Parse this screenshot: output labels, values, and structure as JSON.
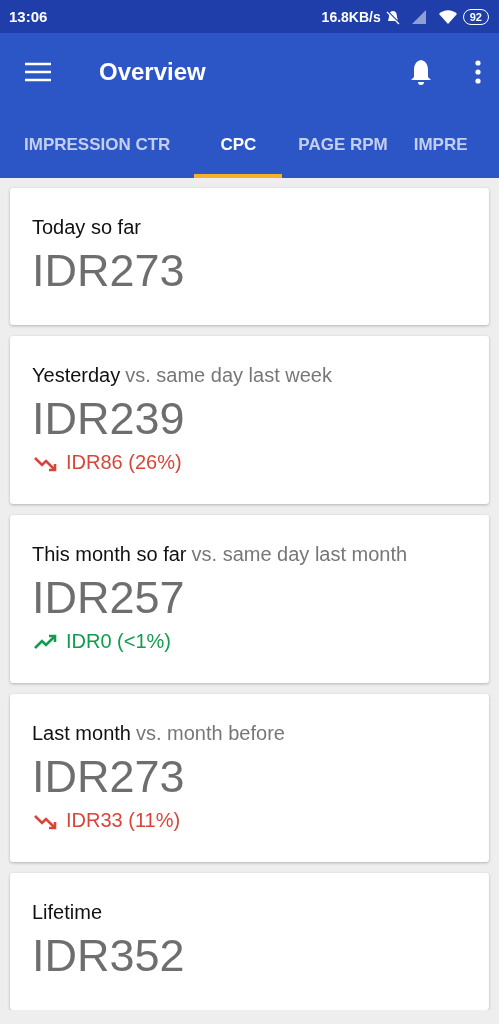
{
  "status_bar": {
    "time": "13:06",
    "speed": "16.8KB/s",
    "battery": "92"
  },
  "app_bar": {
    "title": "Overview"
  },
  "tabs": [
    {
      "label": "IMPRESSION CTR",
      "selected": false
    },
    {
      "label": "CPC",
      "selected": true
    },
    {
      "label": "PAGE RPM",
      "selected": false
    },
    {
      "label": "IMPRE",
      "selected": false
    }
  ],
  "cards": [
    {
      "label": "Today so far",
      "value": "IDR273"
    },
    {
      "label": "Yesterday",
      "comparison": "vs. same day last week",
      "value": "IDR239",
      "change": {
        "kind": "down",
        "text": "IDR86 (26%)"
      }
    },
    {
      "label": "This month so far",
      "comparison": "vs. same day last month",
      "value": "IDR257",
      "change": {
        "kind": "up",
        "text": "IDR0 (<1%)"
      }
    },
    {
      "label": "Last month",
      "comparison": "vs. month before",
      "value": "IDR273",
      "change": {
        "kind": "down",
        "text": "IDR33 (11%)"
      }
    },
    {
      "label": "Lifetime",
      "value": "IDR352"
    }
  ]
}
